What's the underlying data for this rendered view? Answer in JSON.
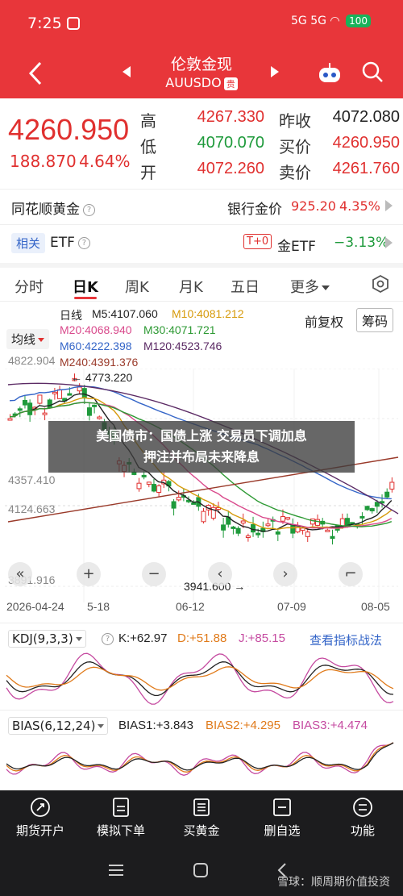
{
  "status_bar": {
    "time": "7:25",
    "indicators": "5G 5G",
    "battery": "100"
  },
  "header": {
    "title": "伦敦金现",
    "symbol": "AUUSDO",
    "tag": "贵"
  },
  "quote": {
    "price": "4260.950",
    "change": "188.870",
    "change_pct": "4.64%",
    "high_label": "高",
    "high": "4267.330",
    "low_label": "低",
    "low": "4070.070",
    "open_label": "开",
    "open": "4072.260",
    "prev_close_label": "昨收",
    "prev_close": "4072.080",
    "bid_label": "买价",
    "bid": "4260.950",
    "ask_label": "卖价",
    "ask": "4261.760"
  },
  "ths_row": {
    "label": "同花顺黄金",
    "bank_label": "银行金价",
    "bank_price": "925.20",
    "bank_pct": "4.35%"
  },
  "etf_row": {
    "tag": "相关",
    "label": "ETF",
    "t0_tag": "T+0",
    "etf_name": "金ETF",
    "etf_pct": "−3.13%"
  },
  "periods": {
    "tabs": [
      "分时",
      "日K",
      "周K",
      "月K",
      "五日",
      "更多"
    ],
    "active": "日K"
  },
  "chart": {
    "ma_selector": "均线",
    "legend_title": "日线",
    "ma5": "M5:4107.060",
    "ma10": "M10:4081.212",
    "ma20": "M20:4068.940",
    "ma30": "M30:4071.721",
    "ma60": "M60:4222.398",
    "ma120": "M120:4523.746",
    "ma240": "M240:4391.376",
    "adjust": "前复权",
    "chips": "筹码",
    "y_ticks": [
      "4822.904",
      "4357.410",
      "4124.663",
      "3891.916"
    ],
    "x_ticks": [
      "2026-04-24",
      "5-18",
      "06-12",
      "07-09",
      "08-05"
    ],
    "high_annotation": "4773.220",
    "low_annotation": "3941.600"
  },
  "chart_data": {
    "type": "candlestick",
    "x_ticks": [
      "2026-04-24",
      "5-18",
      "06-12",
      "07-09",
      "08-05"
    ],
    "y_ticks": [
      4822.904,
      4357.41,
      4124.663,
      3891.916
    ],
    "annotations": {
      "max": 4773.22,
      "min": 3941.6
    },
    "last_close": 4260.95
  },
  "news_banner": {
    "line1": "美国债市：国债上涨 交易员下调加息",
    "line2": "押注并布局未来降息"
  },
  "kdj": {
    "selector": "KDJ(9,3,3)",
    "k": "K:+62.97",
    "d": "D:+51.88",
    "j": "J:+85.15",
    "link": "查看指标战法"
  },
  "bias": {
    "selector": "BIAS(6,12,24)",
    "b1": "BIAS1:+3.843",
    "b2": "BIAS2:+4.295",
    "b3": "BIAS3:+4.474"
  },
  "bottom_nav": {
    "items": [
      "期货开户",
      "模拟下单",
      "买黄金",
      "删自选",
      "功能"
    ]
  },
  "watermark": "雪球：顺周期价值投资",
  "colors": {
    "red": "#e0302f",
    "green": "#1e9a3b",
    "header": "#e8363a"
  }
}
